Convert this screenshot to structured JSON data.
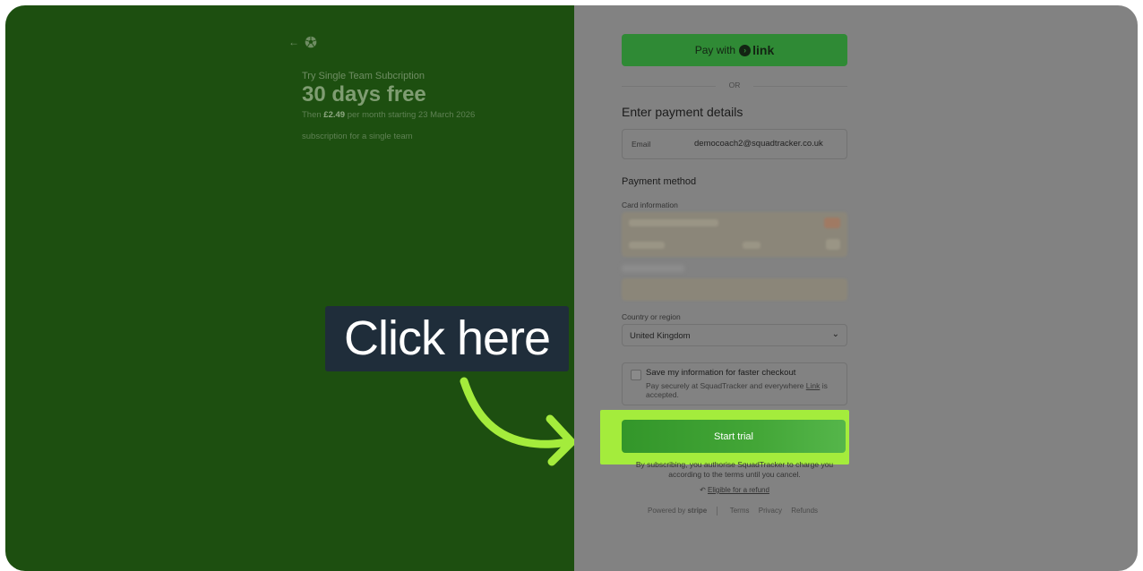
{
  "left": {
    "back_arrow": "←",
    "product_name": "Try Single Team Subcription",
    "price_big": "30 days free",
    "price_sub_prefix": "Then",
    "price_amount": "£2.49",
    "price_sub_suffix": "per month starting 23 March 2026",
    "description": "subscription for a single team"
  },
  "callout": {
    "label": "Click here",
    "arrow_color": "#a4ec3c"
  },
  "checkout": {
    "paylink_prefix": "Pay with",
    "paylink_brand": "link",
    "or_text": "OR",
    "heading": "Enter payment details",
    "email_label": "Email",
    "email_value": "democoach2@squadtracker.co.uk",
    "payment_method_heading": "Payment method",
    "card_label": "Card information",
    "country_label": "Country or region",
    "country_value": "United Kingdom",
    "save_title": "Save my information for faster checkout",
    "save_sub_prefix": "Pay securely at SquadTracker and everywhere",
    "save_sub_link": "Link",
    "save_sub_suffix": "is accepted.",
    "start_button": "Start trial",
    "consent": "By subscribing, you authorise SquadTracker to charge you according to the terms until you cancel.",
    "refund_icon": "↶",
    "refund_text": "Eligible for a refund",
    "footer_powered": "Powered by",
    "footer_brand": "stripe",
    "footer_links": [
      "Terms",
      "Privacy",
      "Refunds"
    ]
  },
  "colors": {
    "left_bg": "#1d4f10",
    "right_overlay": "#828282",
    "accent_green": "#43a637",
    "highlight": "#a4ec3c",
    "callout_bg": "#1f2d3a"
  }
}
